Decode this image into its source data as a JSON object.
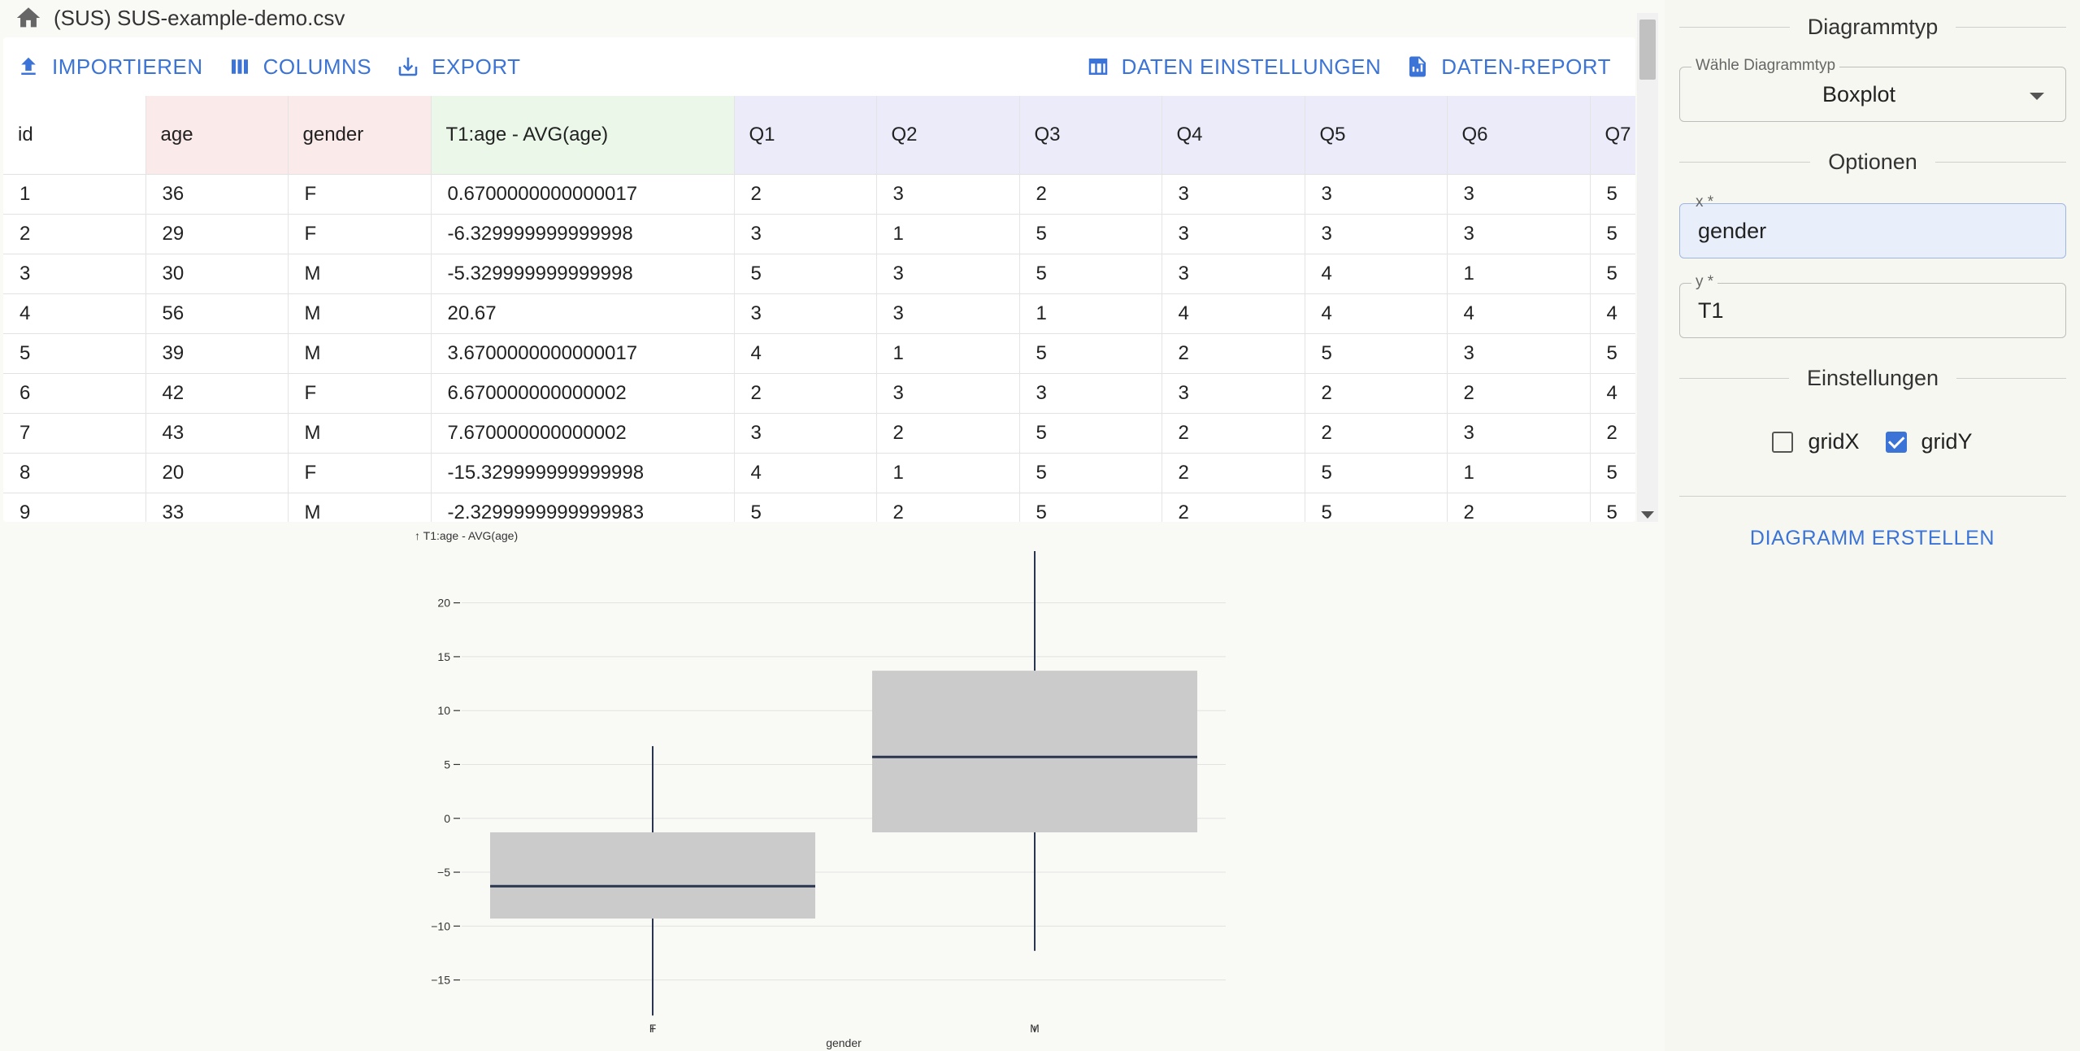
{
  "file": {
    "title": "(SUS) SUS-example-demo.csv"
  },
  "toolbar": {
    "import_label": "IMPORTIEREN",
    "columns_label": "COLUMNS",
    "export_label": "EXPORT",
    "data_settings_label": "DATEN EINSTELLUNGEN",
    "data_report_label": "DATEN-REPORT"
  },
  "table": {
    "columns": [
      "id",
      "age",
      "gender",
      "T1:age - AVG(age)",
      "Q1",
      "Q2",
      "Q3",
      "Q4",
      "Q5",
      "Q6",
      "Q7"
    ],
    "rows": [
      [
        "1",
        "36",
        "F",
        "0.6700000000000017",
        "2",
        "3",
        "2",
        "3",
        "3",
        "3",
        "5"
      ],
      [
        "2",
        "29",
        "F",
        "-6.329999999999998",
        "3",
        "1",
        "5",
        "3",
        "3",
        "3",
        "5"
      ],
      [
        "3",
        "30",
        "M",
        "-5.329999999999998",
        "5",
        "3",
        "5",
        "3",
        "4",
        "1",
        "5"
      ],
      [
        "4",
        "56",
        "M",
        "20.67",
        "3",
        "3",
        "1",
        "4",
        "4",
        "4",
        "4"
      ],
      [
        "5",
        "39",
        "M",
        "3.6700000000000017",
        "4",
        "1",
        "5",
        "2",
        "5",
        "3",
        "5"
      ],
      [
        "6",
        "42",
        "F",
        "6.670000000000002",
        "2",
        "3",
        "3",
        "3",
        "2",
        "2",
        "4"
      ],
      [
        "7",
        "43",
        "M",
        "7.670000000000002",
        "3",
        "2",
        "5",
        "2",
        "2",
        "3",
        "2"
      ],
      [
        "8",
        "20",
        "F",
        "-15.329999999999998",
        "4",
        "1",
        "5",
        "2",
        "5",
        "1",
        "5"
      ],
      [
        "9",
        "33",
        "M",
        "-2.3299999999999983",
        "5",
        "2",
        "5",
        "2",
        "5",
        "2",
        "5"
      ]
    ]
  },
  "chart_data": {
    "type": "boxplot",
    "title": "",
    "ylabel": "↑ T1:age - AVG(age)",
    "xlabel": "gender",
    "categories": [
      "F",
      "M"
    ],
    "ylim": [
      -18.5,
      24.8
    ],
    "yticks": [
      20,
      15,
      10,
      5,
      0,
      -5,
      -10,
      -15
    ],
    "ytick_labels": [
      "20",
      "15",
      "10",
      "5",
      "0",
      "−5",
      "−10",
      "−15"
    ],
    "grid_y": true,
    "grid_x": false,
    "boxes": [
      {
        "category": "F",
        "whisker_low": -18.3,
        "q1": -9.3,
        "median": -6.3,
        "q3": -1.3,
        "whisker_high": 6.7
      },
      {
        "category": "M",
        "whisker_low": -12.3,
        "q1": -1.3,
        "median": 5.7,
        "q3": 13.7,
        "whisker_high": 24.8
      }
    ],
    "box_fill": "#cbcbcb",
    "line_color": "#2a3550"
  },
  "sidebar": {
    "chart_type_heading": "Diagrammtyp",
    "chart_type_label": "Wähle Diagrammtyp",
    "chart_type_value": "Boxplot",
    "options_heading": "Optionen",
    "x_label": "x *",
    "x_value": "gender",
    "y_label": "y *",
    "y_value": "T1",
    "settings_heading": "Einstellungen",
    "gridx_label": "gridX",
    "gridy_label": "gridY",
    "gridx_checked": false,
    "gridy_checked": true,
    "create_label": "DIAGRAMM ERSTELLEN"
  },
  "colors": {
    "accent": "#3b74d6",
    "demo_header": "#faeaea",
    "computed_header": "#ebf7e8",
    "question_header": "#ebebfa"
  }
}
